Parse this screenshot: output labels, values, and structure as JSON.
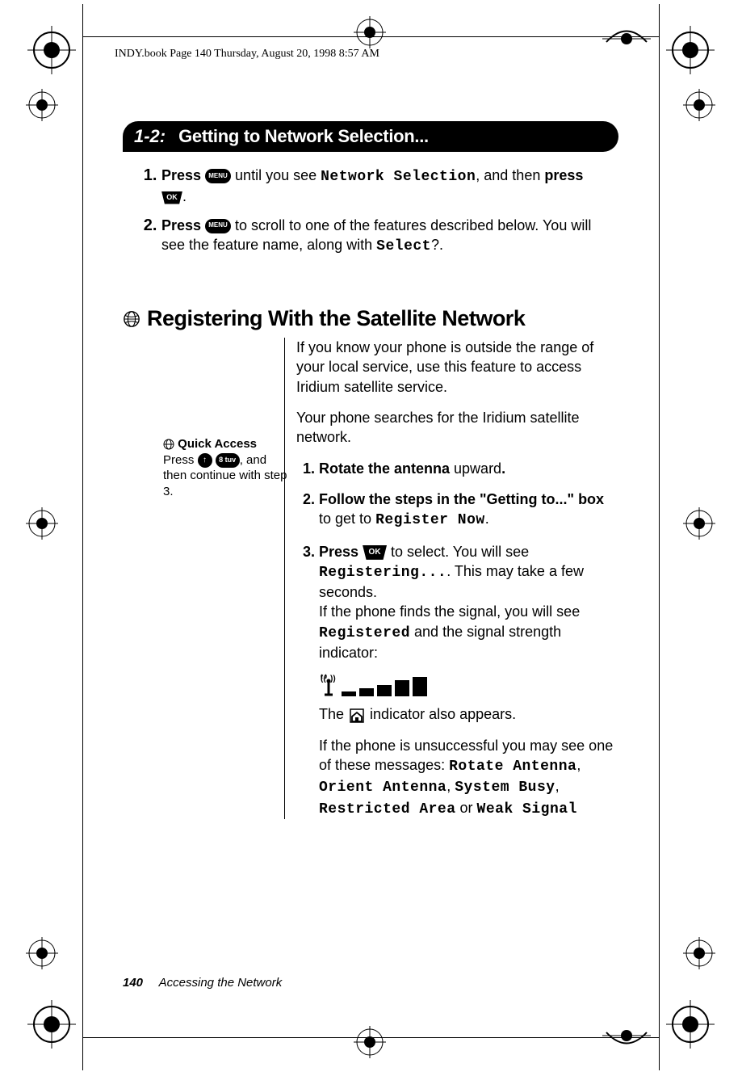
{
  "runhead": "INDY.book  Page 140  Thursday, August 20, 1998  8:57 AM",
  "section": {
    "num": "1-2:",
    "title": "Getting to Network Selection..."
  },
  "steps_box": {
    "step1_a": "Press ",
    "step1_menu": "MENU",
    "step1_b": " until you see ",
    "step1_lcd": "Network Selection",
    "step1_c": ", and then ",
    "step1_d": "press ",
    "step1_ok": "OK",
    "step1_e": ".",
    "step2_a": "Press ",
    "step2_menu": "MENU",
    "step2_b": " to scroll to one of the features described below. You will see the feature name, along with ",
    "step2_lcd": "Select",
    "step2_c": "?."
  },
  "h2": "Registering With the Satellite Network",
  "intro1": "If you know your phone is outside the range of your local service, use this feature to access Iridium satellite service.",
  "intro2": "Your phone searches for the Iridium satellite network.",
  "sidebar": {
    "title": "Quick Access",
    "press": "Press ",
    "btn1": "↑",
    "btn2": "8 tuv",
    "rest": ", and then continue with step 3."
  },
  "substeps": {
    "s1_a": "Rotate the antenna",
    "s1_b": " upward",
    "s1_c": ".",
    "s2_a": "Follow the steps in the \"Getting to...\" box",
    "s2_b": " to get to ",
    "s2_lcd": "Register Now",
    "s2_c": ".",
    "s3_a": "Press ",
    "s3_ok": "OK",
    "s3_b": " to select. You will see ",
    "s3_lcd": "Registering...",
    "s3_c": ". This may take a few seconds.",
    "s3_p2a": "If the phone finds the signal, you will see ",
    "s3_p2lcd": "Registered",
    "s3_p2b": " and the signal strength indicator:",
    "s3_p3a": "The ",
    "s3_p3b": " indicator also appears.",
    "s3_p4a": "If the phone is unsuccessful you may see one of these messages: ",
    "s3_p4m1": "Rotate Antenna",
    "s3_p4c1": ", ",
    "s3_p4m2": "Orient Antenna",
    "s3_p4c2": ", ",
    "s3_p4m3": "System Busy",
    "s3_p4c3": ", ",
    "s3_p4m4": "Restricted Area",
    "s3_p4c4": " or ",
    "s3_p4m5": "Weak Signal"
  },
  "footer": {
    "page": "140",
    "title": "Accessing the Network"
  }
}
